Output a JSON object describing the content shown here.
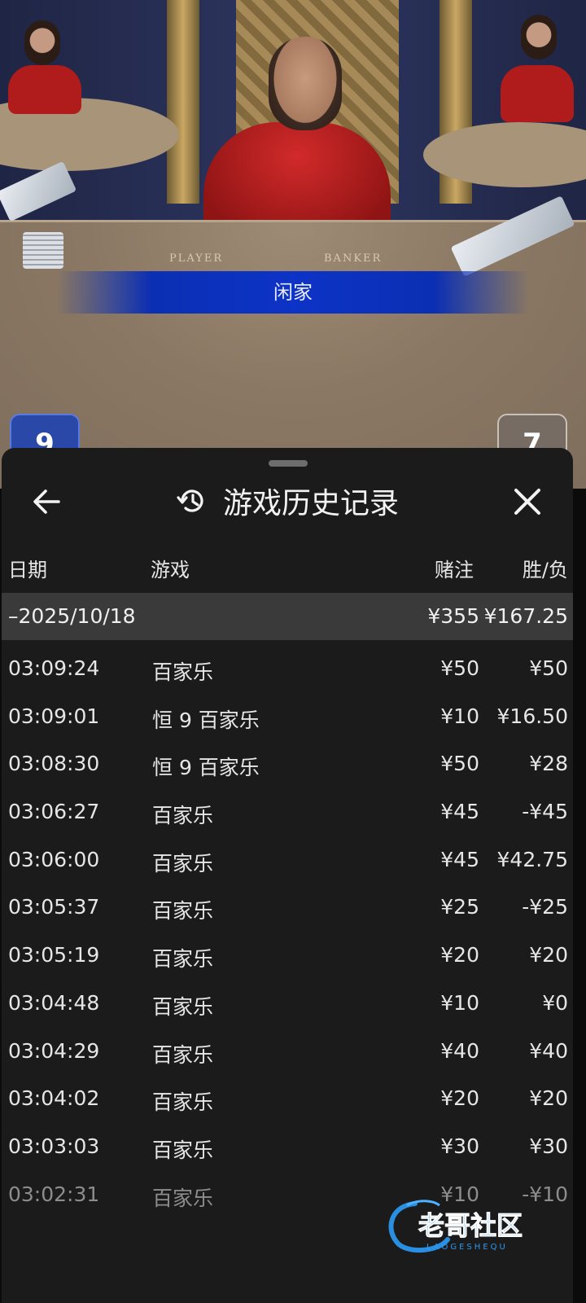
{
  "video": {
    "table_label_player": "PLAYER",
    "table_label_banker": "BANKER",
    "result_banner": "闲家",
    "player_score": "9",
    "banker_score": "7",
    "colors": {
      "player": "#2a48a8",
      "banner": "#0d33c7"
    }
  },
  "sheet": {
    "title": "游戏历史记录",
    "icons": {
      "back": "arrow-left-icon",
      "history": "history-icon",
      "close": "close-icon"
    },
    "columns": {
      "date": "日期",
      "game": "游戏",
      "bet": "赌注",
      "win_loss": "胜/负"
    },
    "date_group": {
      "date": "–2025/10/18",
      "bet": "¥355",
      "win_loss": "¥167.25"
    },
    "rows": [
      {
        "time": "03:09:24",
        "game": "百家乐",
        "bet": "¥50",
        "win_loss": "¥50"
      },
      {
        "time": "03:09:01",
        "game": "恒 9 百家乐",
        "bet": "¥10",
        "win_loss": "¥16.50"
      },
      {
        "time": "03:08:30",
        "game": "恒 9 百家乐",
        "bet": "¥50",
        "win_loss": "¥28"
      },
      {
        "time": "03:06:27",
        "game": "百家乐",
        "bet": "¥45",
        "win_loss": "-¥45"
      },
      {
        "time": "03:06:00",
        "game": "百家乐",
        "bet": "¥45",
        "win_loss": "¥42.75"
      },
      {
        "time": "03:05:37",
        "game": "百家乐",
        "bet": "¥25",
        "win_loss": "-¥25"
      },
      {
        "time": "03:05:19",
        "game": "百家乐",
        "bet": "¥20",
        "win_loss": "¥20"
      },
      {
        "time": "03:04:48",
        "game": "百家乐",
        "bet": "¥10",
        "win_loss": "¥0"
      },
      {
        "time": "03:04:29",
        "game": "百家乐",
        "bet": "¥40",
        "win_loss": "¥40"
      },
      {
        "time": "03:04:02",
        "game": "百家乐",
        "bet": "¥20",
        "win_loss": "¥20"
      },
      {
        "time": "03:03:03",
        "game": "百家乐",
        "bet": "¥30",
        "win_loss": "¥30"
      },
      {
        "time": "03:02:31",
        "game": "百家乐",
        "bet": "¥10",
        "win_loss": "-¥10"
      }
    ]
  },
  "watermark": {
    "text": "老哥社区",
    "subtext": "LAOGESHEQU"
  }
}
